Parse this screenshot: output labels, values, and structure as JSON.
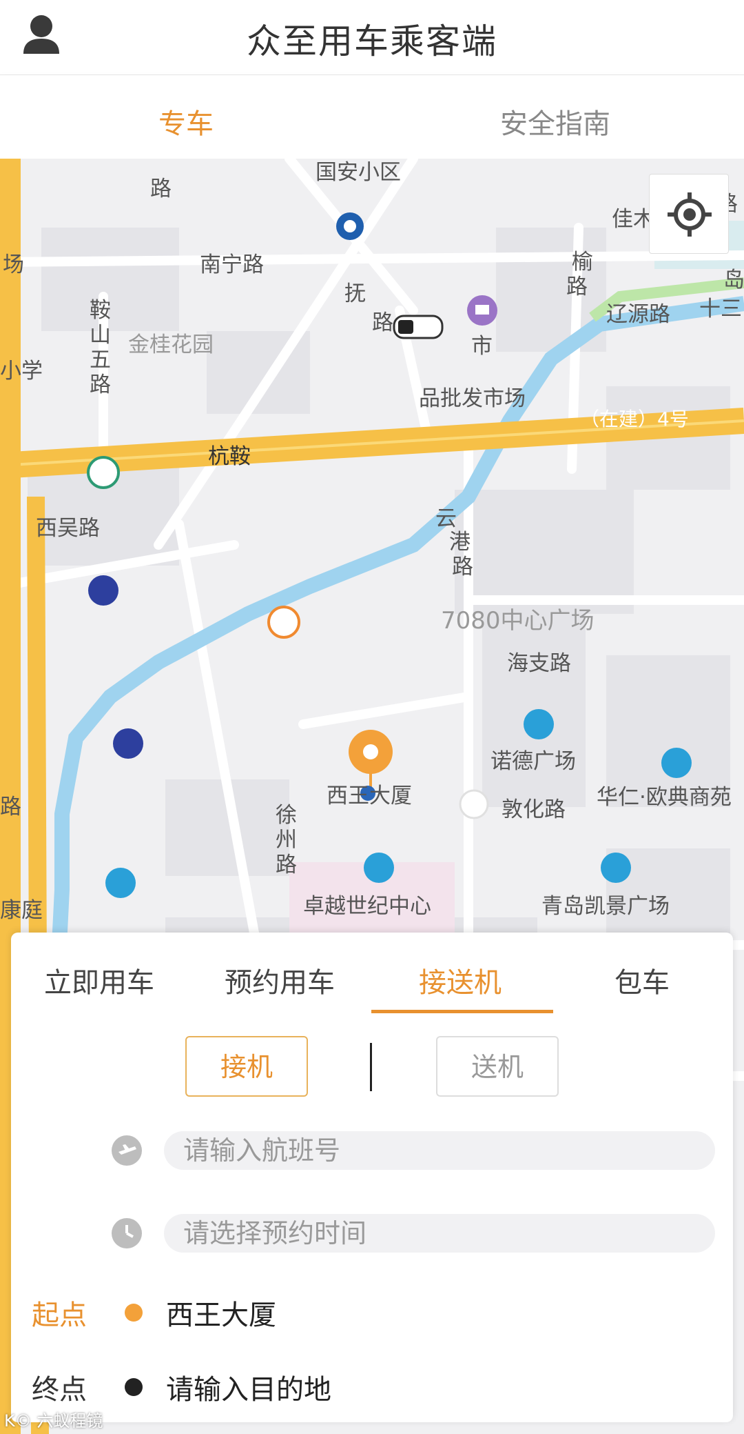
{
  "header": {
    "title": "众至用车乘客端",
    "avatar_icon": "user-icon"
  },
  "top_tabs": [
    {
      "label": "专车",
      "active": true
    },
    {
      "label": "安全指南",
      "active": false
    }
  ],
  "map": {
    "labels": {
      "road_lu": "路",
      "guoan": "国安小区",
      "jiamu": "佳木",
      "lu2": "路",
      "chang": "场",
      "nanning": "南宁路",
      "yu": "榆",
      "lu_yu": "路",
      "liaoyuan": "辽源路",
      "dao": "岛",
      "shisan": "十三",
      "anshan1": "鞍",
      "anshan2": "山",
      "anshan3": "五",
      "anshan4": "路",
      "jingui": "金桂花园",
      "xiaoxue": "小学",
      "fu": "抚",
      "lu_fu": "路",
      "shi": "市",
      "pifa": "品批发市场",
      "zaijian": "（在建）4号",
      "hangan": "杭鞍",
      "xiwu": "西吴路",
      "yun": "云",
      "gang": "港",
      "lu_yun": "路",
      "plaza7080": "7080中心广场",
      "haizhi": "海支路",
      "nuode": "诺德广场",
      "xiwang": "西王大厦",
      "lu_left": "路",
      "xu": "徐",
      "zhou": "州",
      "lu_xu": "路",
      "dunhua": "敦化路",
      "huaren": "华仁·欧典商苑",
      "zhuoyue": "卓越世纪中心",
      "kaijing": "青岛凯景广场",
      "kangting": "康庭"
    },
    "locate_icon": "crosshair-icon"
  },
  "booking": {
    "mode_tabs": [
      {
        "label": "立即用车",
        "active": false
      },
      {
        "label": "预约用车",
        "active": false
      },
      {
        "label": "接送机",
        "active": true
      },
      {
        "label": "包车",
        "active": false
      }
    ],
    "sub_options": [
      {
        "label": "接机",
        "active": true
      },
      {
        "label": "送机",
        "active": false
      }
    ],
    "flight_field": {
      "placeholder": "请输入航班号",
      "icon": "plane-icon"
    },
    "time_field": {
      "placeholder": "请选择预约时间",
      "icon": "clock-icon"
    },
    "start": {
      "label": "起点",
      "value": "西王大厦",
      "color": "#f3a13a"
    },
    "end": {
      "label": "终点",
      "value": "请输入目的地",
      "color": "#222222"
    }
  },
  "colors": {
    "accent": "#e8912f",
    "highway": "#f6c047",
    "river": "#9fd3ef",
    "map_bg": "#f3f3f5"
  },
  "watermark": "K© 六蚁程镜"
}
